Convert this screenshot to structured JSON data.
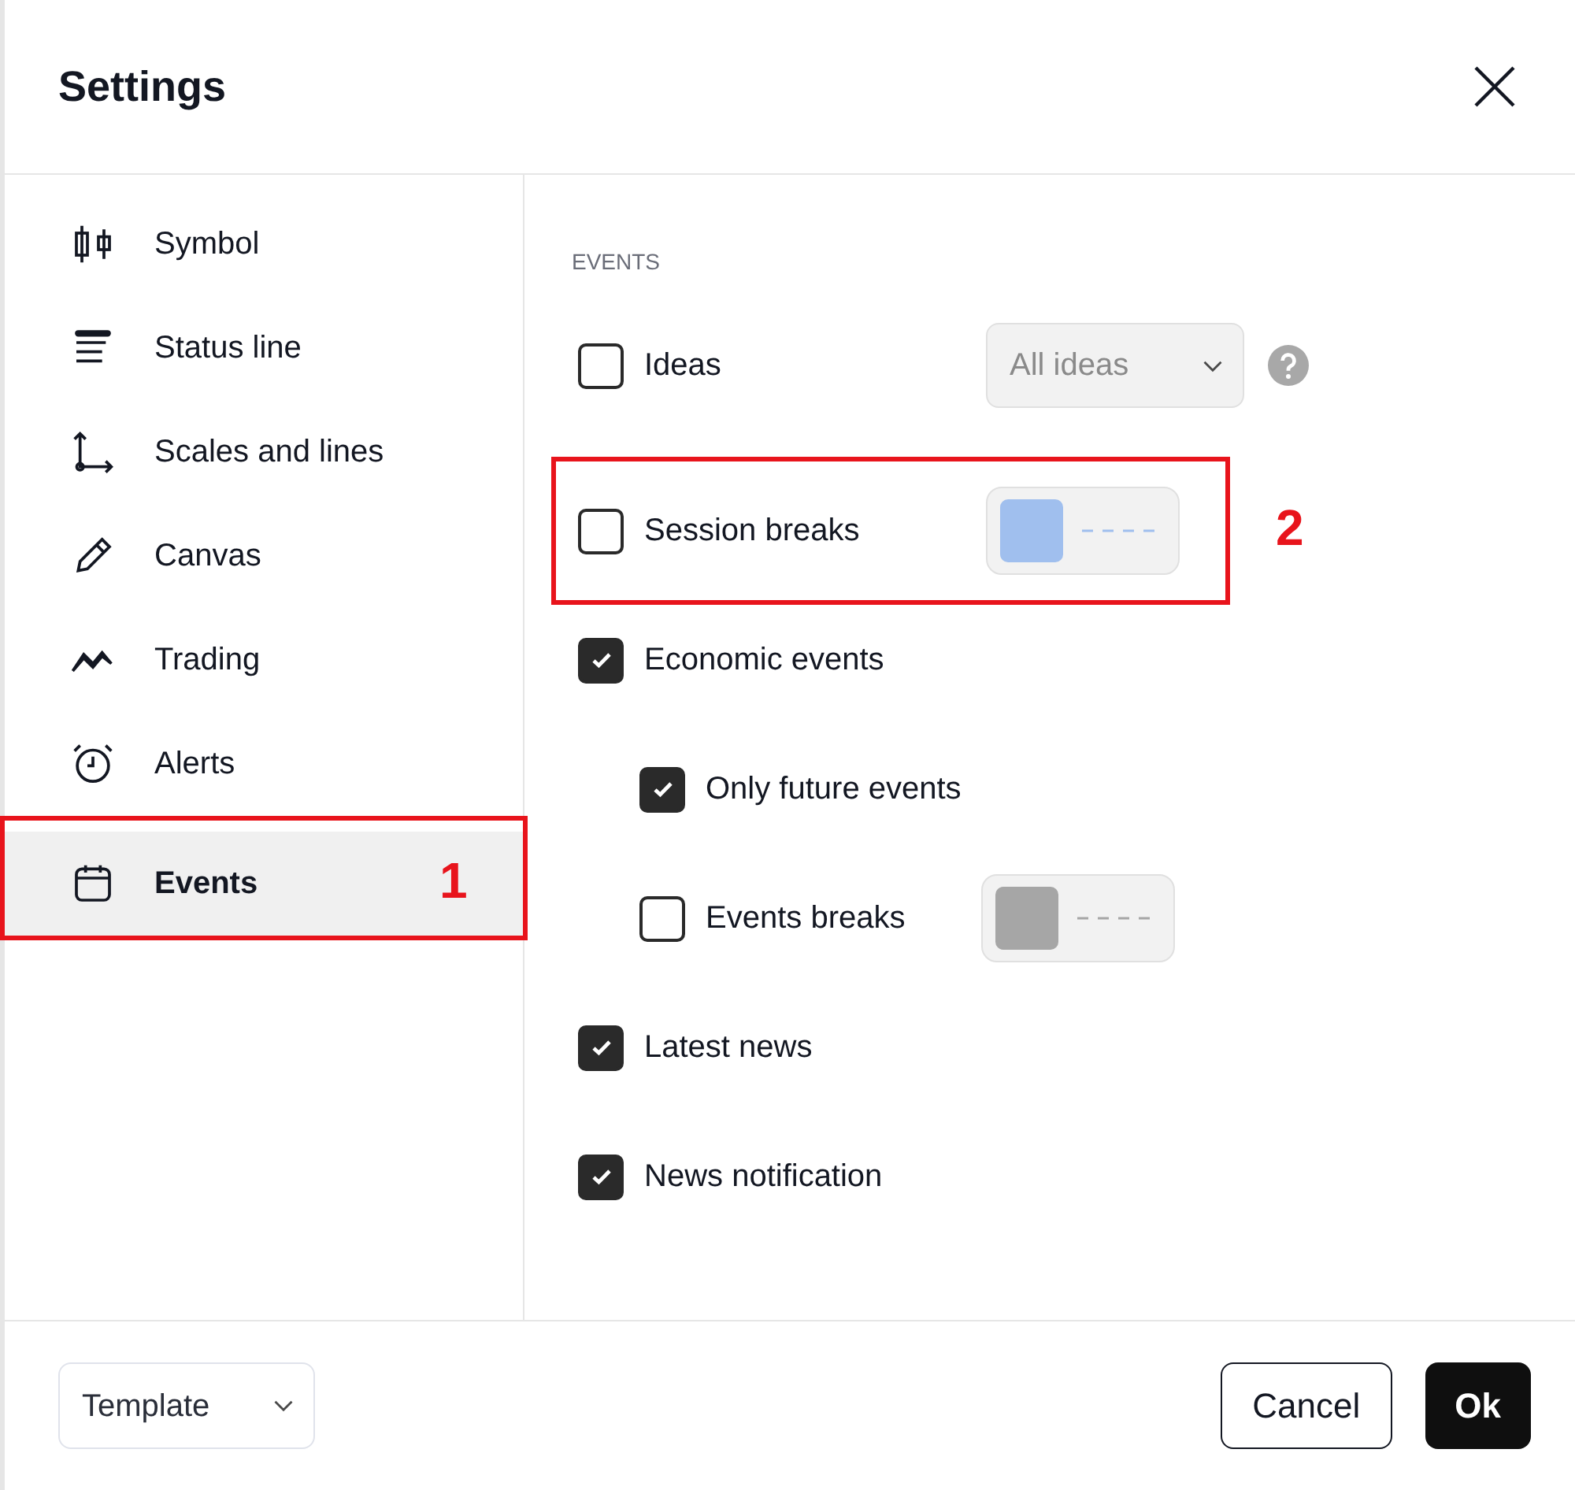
{
  "dialog": {
    "title": "Settings"
  },
  "sidebar": {
    "items": [
      {
        "label": "Symbol",
        "selected": false
      },
      {
        "label": "Status line",
        "selected": false
      },
      {
        "label": "Scales and lines",
        "selected": false
      },
      {
        "label": "Canvas",
        "selected": false
      },
      {
        "label": "Trading",
        "selected": false
      },
      {
        "label": "Alerts",
        "selected": false
      },
      {
        "label": "Events",
        "selected": true,
        "annotation": "1"
      }
    ]
  },
  "section": {
    "heading": "EVENTS",
    "options": [
      {
        "label": "Ideas",
        "checked": false,
        "kind": "dropdown",
        "value": "All ideas",
        "help": true
      },
      {
        "label": "Session breaks",
        "checked": false,
        "kind": "style",
        "color": "#a0bfee",
        "annotation": "2"
      },
      {
        "label": "Economic events",
        "checked": true,
        "kind": "plain",
        "children": [
          {
            "label": "Only future events",
            "checked": true,
            "kind": "plain"
          },
          {
            "label": "Events breaks",
            "checked": false,
            "kind": "style",
            "color": "#a6a6a6"
          }
        ]
      },
      {
        "label": "Latest news",
        "checked": true,
        "kind": "plain"
      },
      {
        "label": "News notification",
        "checked": true,
        "kind": "plain"
      }
    ]
  },
  "footer": {
    "template": "Template",
    "buttons": [
      {
        "label": "Cancel",
        "kind": "secondary"
      },
      {
        "label": "Ok",
        "kind": "primary"
      }
    ]
  }
}
